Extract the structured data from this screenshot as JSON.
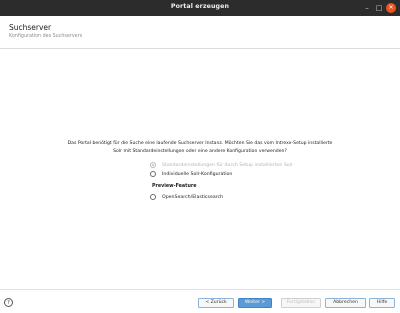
{
  "window": {
    "title": "Portal erzeugen",
    "controls": {
      "minimize": "–",
      "maximize": "□",
      "close": "✕"
    }
  },
  "header": {
    "title": "Suchserver",
    "subtitle": "Konfiguration des Suchservers"
  },
  "main": {
    "intro_line1": "Das Portal benötigt für die Suche eine laufende Suchserver Instanz. Möchten Sie das vom Intrexx-Setup installierte",
    "intro_line2": "Solr mit Standardeinstellungen oder eine andere Konfiguration verwenden?",
    "options": [
      {
        "label": "Standardeinstellungen für durch Setup installierten Solr",
        "checked": true,
        "disabled": true
      },
      {
        "label": "Individuelle Solr-Konfiguration",
        "checked": false,
        "disabled": false
      }
    ],
    "preview_heading": "Preview-Feature",
    "preview_options": [
      {
        "label": "OpenSearch/Elasticsearch",
        "checked": false,
        "disabled": false
      }
    ]
  },
  "footer": {
    "help_icon": "?",
    "buttons": {
      "back": "< Zurück",
      "next": "Weiter >",
      "finish": "Fertigstellen",
      "cancel": "Abbrechen",
      "help": "Hilfe"
    }
  },
  "colors": {
    "titlebar_bg": "#2c2c2c",
    "close_button": "#e95420",
    "primary_button": "#5a9ad6",
    "button_border": "#8ab4dc"
  }
}
